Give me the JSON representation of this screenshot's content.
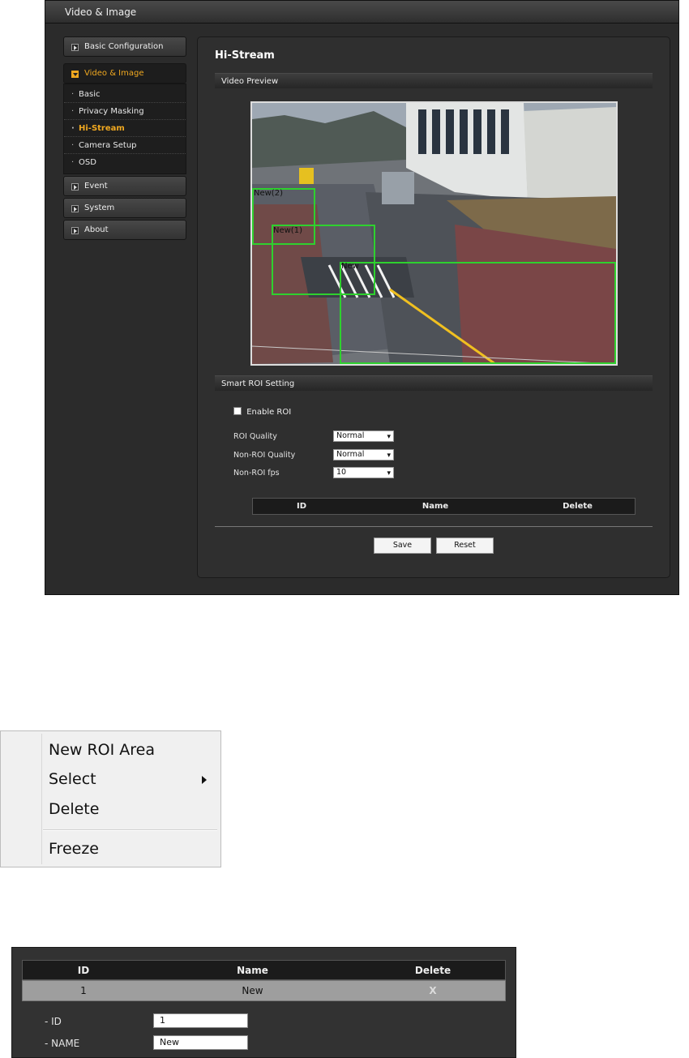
{
  "window": {
    "title": "Video & Image"
  },
  "sidebar": {
    "groups": [
      {
        "label": "Basic Configuration"
      },
      {
        "label": "Video & Image"
      },
      {
        "label": "Event"
      },
      {
        "label": "System"
      },
      {
        "label": "About"
      }
    ],
    "sub_items": [
      {
        "label": "Basic"
      },
      {
        "label": "Privacy Masking"
      },
      {
        "label": "Hi-Stream"
      },
      {
        "label": "Camera Setup"
      },
      {
        "label": "OSD"
      }
    ]
  },
  "content": {
    "page_title": "Hi-Stream",
    "video_preview_label": "Video Preview",
    "roi_labels": [
      "New(2)",
      "New(1)",
      "New"
    ],
    "smart_roi_label": "Smart ROI Setting",
    "enable_roi_label": "Enable ROI",
    "enable_roi_checked": false,
    "settings": [
      {
        "label": "ROI Quality",
        "value": "Normal"
      },
      {
        "label": "Non-ROI Quality",
        "value": "Normal"
      },
      {
        "label": "Non-ROI fps",
        "value": "10"
      }
    ],
    "table_headers": {
      "id": "ID",
      "name": "Name",
      "delete": "Delete"
    },
    "buttons": {
      "save": "Save",
      "reset": "Reset"
    }
  },
  "context_menu": {
    "items": [
      "New ROI Area",
      "Select",
      "Delete",
      "Freeze"
    ]
  },
  "roi_detail": {
    "headers": {
      "id": "ID",
      "name": "Name",
      "delete": "Delete"
    },
    "row": {
      "id": "1",
      "name": "New",
      "delete": "X"
    },
    "fields": [
      {
        "label": "- ID",
        "value": "1"
      },
      {
        "label": "- NAME",
        "value": "New"
      }
    ]
  },
  "colors": {
    "accent": "#f0a820",
    "roi_box": "#2ed12e",
    "panel": "#2f2f2f"
  },
  "icons": {
    "nav_group": "square-arrow-icon",
    "submenu": "submenu-arrow-icon",
    "select": "chevron-down-icon"
  }
}
